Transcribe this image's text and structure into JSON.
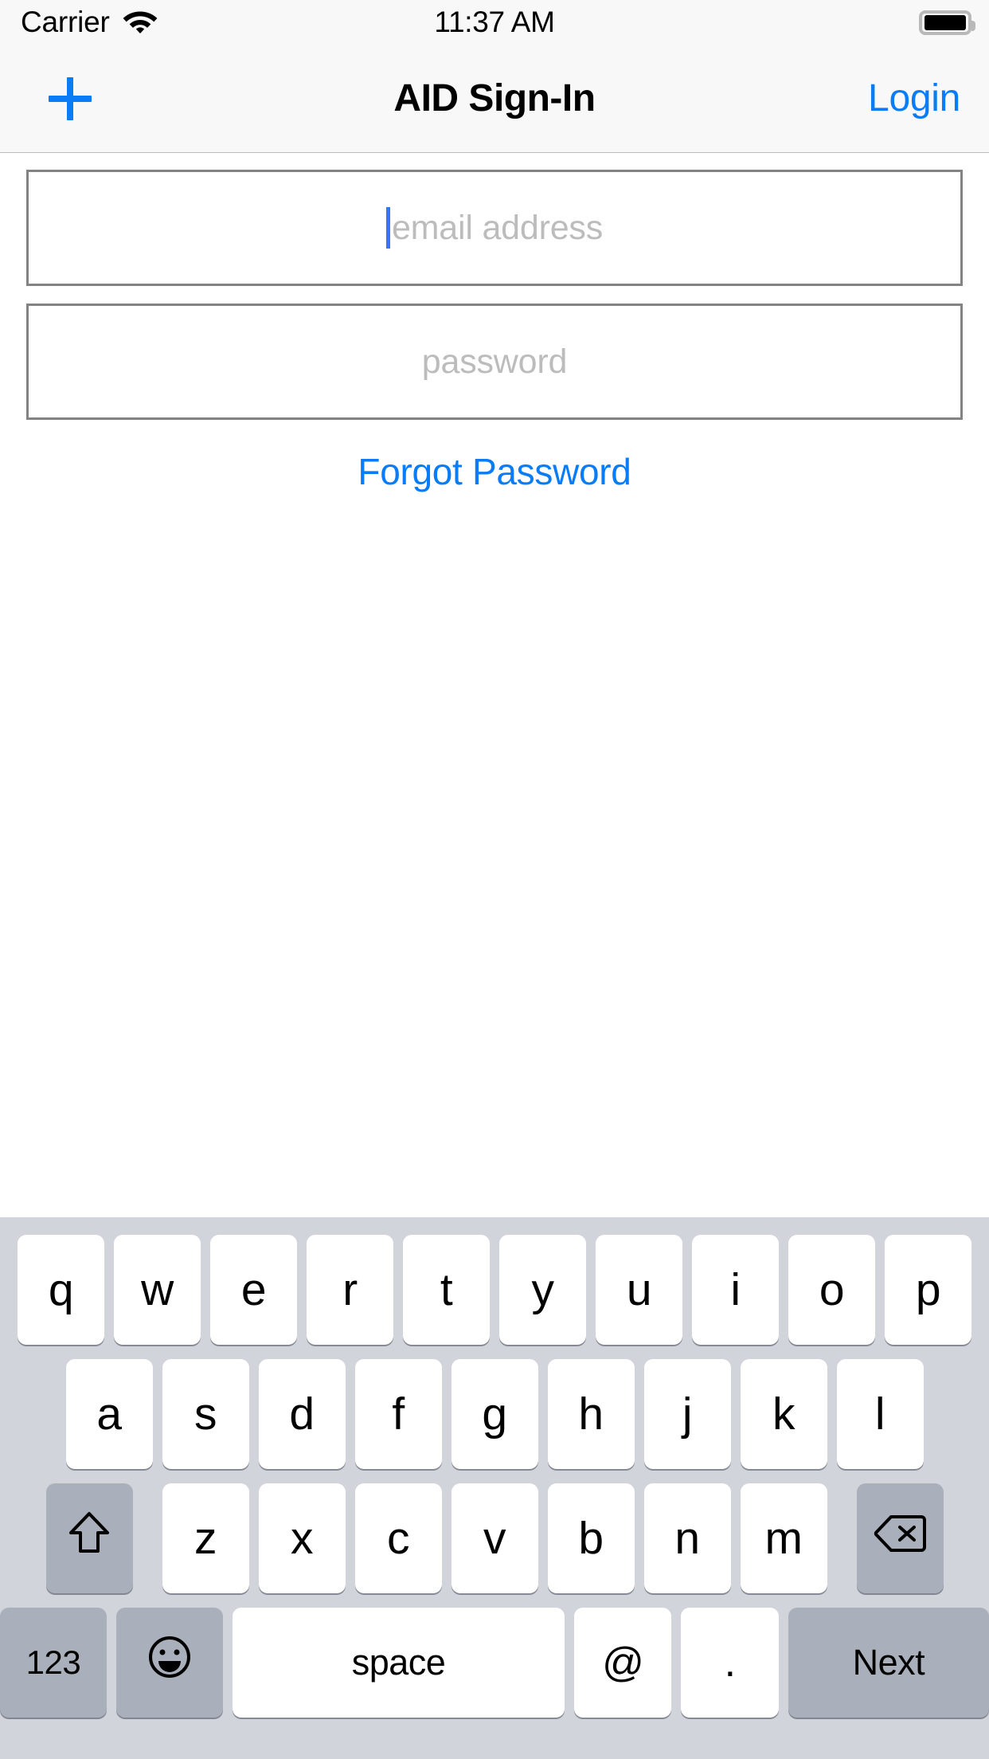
{
  "status_bar": {
    "carrier": "Carrier",
    "wifi_icon": "wifi-icon",
    "time": "11:37 AM",
    "battery_icon": "battery-full-icon"
  },
  "nav_bar": {
    "add_icon": "plus-icon",
    "title": "AID Sign-In",
    "login_label": "Login"
  },
  "form": {
    "email": {
      "value": "",
      "placeholder": "email address",
      "caret_color": "#3477f5"
    },
    "password": {
      "value": "",
      "placeholder": "password"
    },
    "forgot_password_label": "Forgot Password"
  },
  "keyboard": {
    "row1": [
      "q",
      "w",
      "e",
      "r",
      "t",
      "y",
      "u",
      "i",
      "o",
      "p"
    ],
    "row2": [
      "a",
      "s",
      "d",
      "f",
      "g",
      "h",
      "j",
      "k",
      "l"
    ],
    "row3": {
      "shift_icon": "shift-icon",
      "letters": [
        "z",
        "x",
        "c",
        "v",
        "b",
        "n",
        "m"
      ],
      "backspace_icon": "backspace-icon"
    },
    "row4": {
      "numbers_label": "123",
      "emoji_icon": "emoji-smiley-icon",
      "space_label": "space",
      "at_label": "@",
      "period_label": ".",
      "next_label": "Next"
    }
  },
  "colors": {
    "accent_blue": "#0a7cf5",
    "placeholder_gray": "#bcbcbc",
    "field_border": "#838383",
    "keyboard_bg": "#d1d4da",
    "key_dark": "#aab0bb",
    "bar_bg": "#f8f8f8"
  }
}
